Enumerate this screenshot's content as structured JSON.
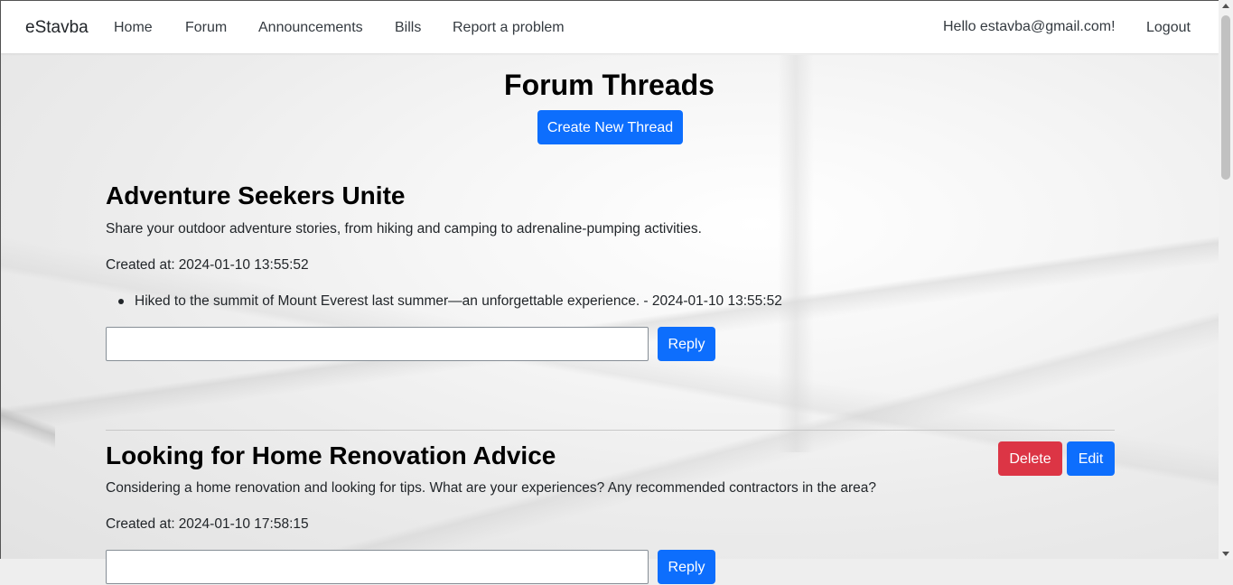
{
  "nav": {
    "brand": "eStavba",
    "items": [
      "Home",
      "Forum",
      "Announcements",
      "Bills",
      "Report a problem"
    ],
    "greeting": "Hello estavba@gmail.com!",
    "logout": "Logout"
  },
  "page": {
    "title": "Forum Threads",
    "create_button": "Create New Thread"
  },
  "threads": [
    {
      "title": "Adventure Seekers Unite",
      "description": "Share your outdoor adventure stories, from hiking and camping to adrenaline-pumping activities.",
      "created_label": "Created at:",
      "created_at": "2024-01-10 13:55:52",
      "replies": [
        "Hiked to the summit of Mount Everest last summer—an unforgettable experience. - 2024-01-10 13:55:52"
      ],
      "reply_input_value": "",
      "reply_button": "Reply"
    },
    {
      "title": "Looking for Home Renovation Advice",
      "description": "Considering a home renovation and looking for tips. What are your experiences? Any recommended contractors in the area?",
      "created_label": "Created at:",
      "created_at": "2024-01-10 17:58:15",
      "delete_button": "Delete",
      "edit_button": "Edit",
      "reply_input_value": "",
      "reply_button": "Reply"
    }
  ],
  "colors": {
    "primary": "#0d6efd",
    "danger": "#dc3545",
    "navbar_bg": "#ffffff"
  }
}
